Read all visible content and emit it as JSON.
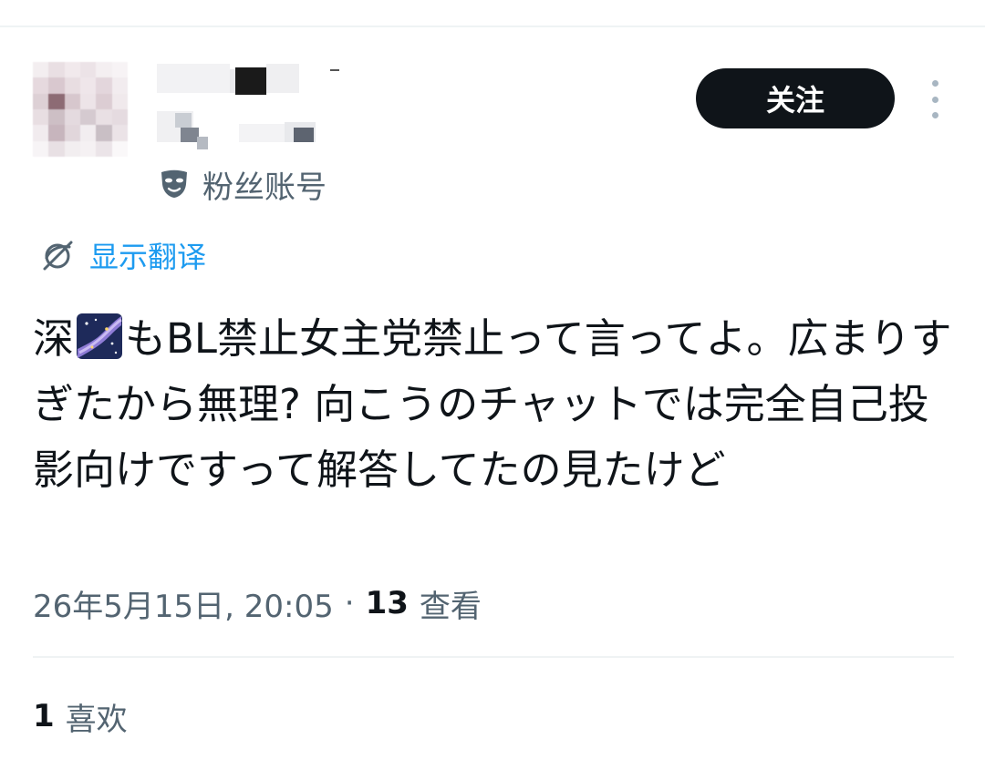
{
  "header": {
    "follow_label": "关注",
    "account_label": "粉丝账号"
  },
  "translate": {
    "label": "显示翻译"
  },
  "tweet": {
    "text_before_emoji": "深",
    "text_after_emoji": "もBL禁止女主党禁止って言ってよ。広まりすぎたから無理? 向こうのチャットでは完全自己投影向けですって解答してたの見たけど",
    "emoji": "milky-way-emoji"
  },
  "meta": {
    "timestamp": "26年5月15日, 20:05",
    "separator": "·",
    "views_count": "13",
    "views_label": "查看"
  },
  "stats": {
    "likes_count": "1",
    "likes_label": "喜欢"
  },
  "colors": {
    "link": "#1d9bf0",
    "secondary_text": "#536471",
    "primary_text": "#0f1419",
    "follow_bg": "#0f1419",
    "divider": "#eff3f4"
  }
}
